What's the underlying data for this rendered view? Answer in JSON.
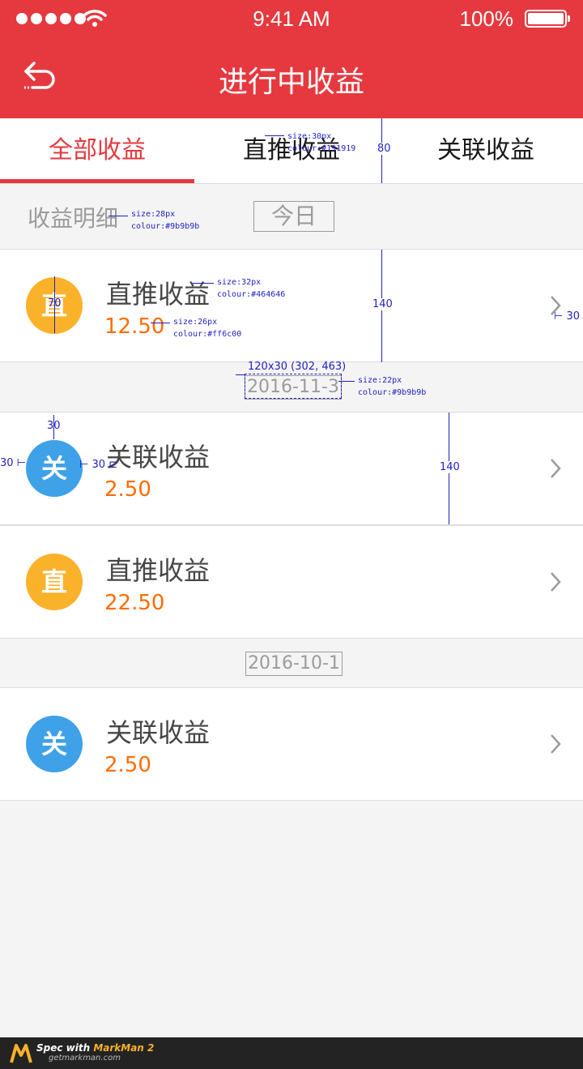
{
  "status_bar": {
    "time": "9:41 AM",
    "battery_percent": "100%",
    "battery_level": 1.0,
    "signal_dots": 5,
    "wifi_icon": "wifi-icon"
  },
  "header": {
    "title": "进行中收益",
    "back_icon": "back-arrow-icon",
    "background": "#e5393f"
  },
  "tabs": [
    {
      "label": "全部收益",
      "active": true
    },
    {
      "label": "直推收益",
      "active": false
    },
    {
      "label": "关联收益",
      "active": false
    }
  ],
  "section": {
    "label": "收益明细",
    "filter_button": "今日"
  },
  "groups": [
    {
      "date": "",
      "items": [
        {
          "avatar_char": "直",
          "title": "直推收益",
          "amount": "12.50"
        }
      ]
    },
    {
      "date": "2016-11-3",
      "items": [
        {
          "avatar_char": "关",
          "title": "关联收益",
          "amount": "2.50"
        },
        {
          "avatar_char": "直",
          "title": "直推收益",
          "amount": "22.50"
        }
      ]
    },
    {
      "date": "2016-10-1",
      "items": [
        {
          "avatar_char": "关",
          "title": "关联收益",
          "amount": "2.50"
        }
      ]
    }
  ],
  "colors": {
    "accent": "#e5393f",
    "amount": "#ff6c00",
    "title_text": "#464646",
    "muted": "#9b9b9b",
    "tab_text": "#191919",
    "avatar_zhi": "#fbb22b",
    "avatar_guan": "#3fa1e8"
  },
  "annotations": {
    "tab_font": [
      "size:30px",
      "colour:#191919"
    ],
    "tab_height": "80",
    "section_font": [
      "size:28px",
      "colour:#9b9b9b"
    ],
    "avatar_size": "70",
    "title_font": [
      "size:32px",
      "colour:#464646"
    ],
    "amount_font": [
      "size:26px",
      "colour:#ff6c00"
    ],
    "row_height_1": "140",
    "right_margin": "30",
    "date_box": "120x30 (302, 463)",
    "date_font": [
      "size:22px",
      "colour:#9b9b9b"
    ],
    "top_margin": "30",
    "left_margin": "30",
    "avatar_gap": "30",
    "row_height_2": "140"
  },
  "footer": {
    "brand_prefix": "Spec with ",
    "brand_name": "MarkMan 2",
    "url": "getmarkman.com",
    "logo_icon": "markman-logo-icon"
  }
}
